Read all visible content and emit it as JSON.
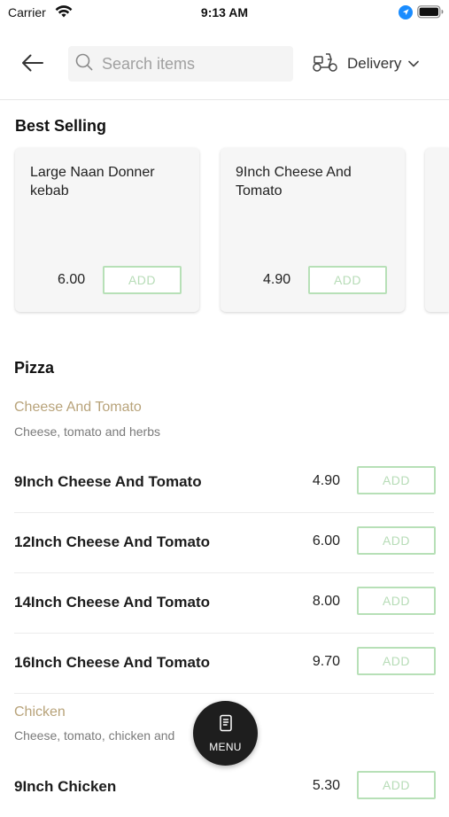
{
  "status_bar": {
    "carrier": "Carrier",
    "time": "9:13 AM",
    "icons": [
      "wifi-icon",
      "location-icon",
      "battery-icon"
    ]
  },
  "header": {
    "back_icon": "arrow-left-icon",
    "search": {
      "placeholder": "Search items",
      "value": "",
      "icon": "search-icon"
    },
    "delivery": {
      "label": "Delivery",
      "icon": "scooter-icon",
      "chevron": "chevron-down-icon"
    }
  },
  "best_selling": {
    "title": "Best Selling",
    "items": [
      {
        "name": "Large Naan Donner kebab",
        "price": "6.00",
        "add_label": "ADD"
      },
      {
        "name": "9Inch Cheese And Tomato",
        "price": "4.90",
        "add_label": "ADD"
      }
    ]
  },
  "pizza": {
    "title": "Pizza",
    "subcategories": [
      {
        "name": "Cheese And Tomato",
        "description": "Cheese, tomato and herbs",
        "items": [
          {
            "name": "9Inch Cheese And Tomato",
            "price": "4.90",
            "add_label": "ADD"
          },
          {
            "name": "12Inch Cheese And Tomato",
            "price": "6.00",
            "add_label": "ADD"
          },
          {
            "name": "14Inch Cheese And Tomato",
            "price": "8.00",
            "add_label": "ADD"
          },
          {
            "name": "16Inch Cheese And Tomato",
            "price": "9.70",
            "add_label": "ADD"
          }
        ]
      },
      {
        "name": "Chicken",
        "description": "Cheese, tomato, chicken and",
        "items": [
          {
            "name": "9Inch Chicken",
            "price": "5.30",
            "add_label": "ADD"
          }
        ]
      }
    ]
  },
  "menu_button": {
    "label": "MENU",
    "icon": "menu-book-icon"
  },
  "colors": {
    "accent_green": "#b7e0b7",
    "subcategory_gold": "#b8a37a",
    "fab_dark": "#1e1e1e",
    "location_blue": "#1a8cff"
  }
}
